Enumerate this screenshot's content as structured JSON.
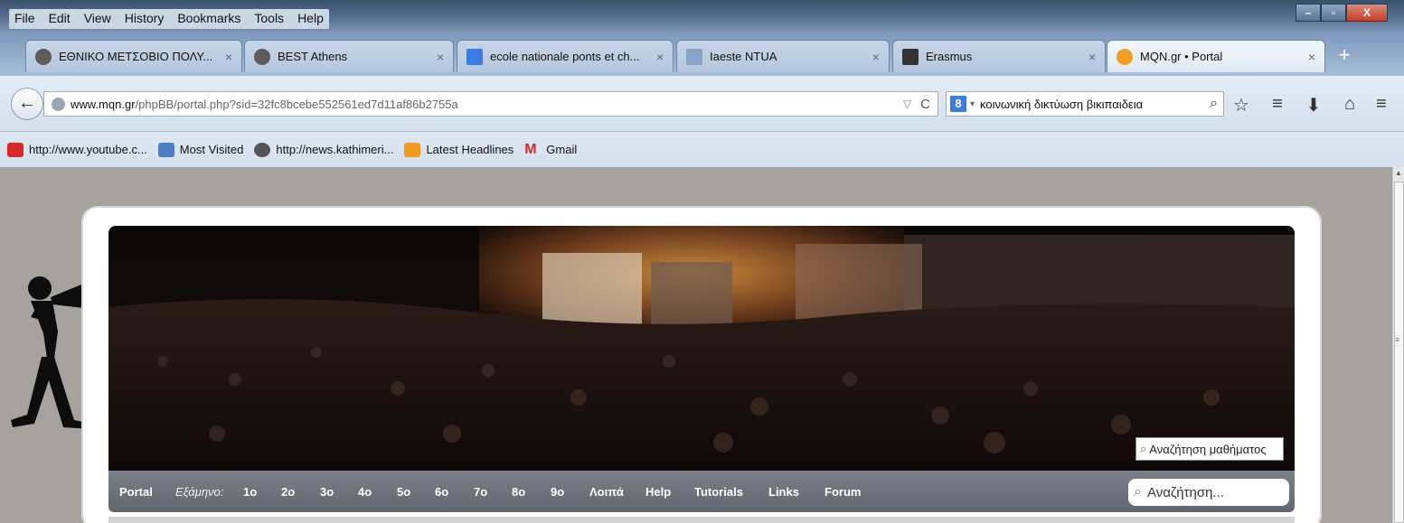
{
  "menubar": {
    "items": [
      "File",
      "Edit",
      "View",
      "History",
      "Bookmarks",
      "Tools",
      "Help"
    ],
    "window_controls": {
      "minimize": "–",
      "maximize": "▫",
      "close": "X"
    }
  },
  "tabs": [
    {
      "label": "ΕΘΝΙΚΟ ΜΕΤΣΟΒΙΟ ΠΟΛΥ...",
      "icon": "seal-icon",
      "color": "#5c5c5c",
      "active": false
    },
    {
      "label": "BEST Athens",
      "icon": "seal-icon",
      "color": "#5c5c5c",
      "active": false
    },
    {
      "label": "ecole nationale ponts et ch...",
      "icon": "google-icon",
      "color": "#3b7ce0",
      "active": false
    },
    {
      "label": "Iaeste NTUA",
      "icon": "page-icon",
      "color": "#8aa4c8",
      "active": false
    },
    {
      "label": "Erasmus",
      "icon": "erasmus-icon",
      "color": "#333333",
      "active": false
    },
    {
      "label": "MQN.gr • Portal",
      "icon": "mqn-icon",
      "color": "#f0a020",
      "active": true
    }
  ],
  "tab_close_glyph": "×",
  "new_tab_glyph": "+",
  "navbar": {
    "back_glyph": "←",
    "url_host": "www.mqn.gr",
    "url_path": "/phpBB/portal.php?sid=32fc8bcebe552561ed7d11af86b2755a",
    "dropdown_glyph": "▽",
    "reload_glyph": "C",
    "search_engine_glyph": "8",
    "search_query": "κοινωνική δικτύωση βικιπαιδεια",
    "search_glyph": "⌕",
    "tool_glyphs": {
      "star": "☆",
      "reader": "≡",
      "download": "⬇",
      "home": "⌂",
      "menu": "≡"
    }
  },
  "bookmarks": [
    {
      "label": "http://www.youtube.c...",
      "icon": "youtube-icon",
      "color": "#d8262a"
    },
    {
      "label": "Most Visited",
      "icon": "most-visited-icon",
      "color": "#4a7fc8"
    },
    {
      "label": "http://news.kathimeri...",
      "icon": "kathimerini-icon",
      "color": "#555555"
    },
    {
      "label": "Latest Headlines",
      "icon": "rss-icon",
      "color": "#f29a1f"
    },
    {
      "label": "Gmail",
      "icon": "gmail-icon",
      "color": "#d8262a"
    }
  ],
  "site": {
    "banner_search_placeholder": "Αναζήτηση μαθήματος",
    "nav": {
      "portal": "Portal",
      "semester_label": "Εξάμηνο:",
      "semesters": [
        "1ο",
        "2ο",
        "3ο",
        "4ο",
        "5ο",
        "6ο",
        "7ο",
        "8ο",
        "9ο"
      ],
      "others": "Λοιπά",
      "help": "Help",
      "tutorials": "Tutorials",
      "links": "Links",
      "forum": "Forum"
    },
    "search_placeholder": "Αναζήτηση..."
  }
}
